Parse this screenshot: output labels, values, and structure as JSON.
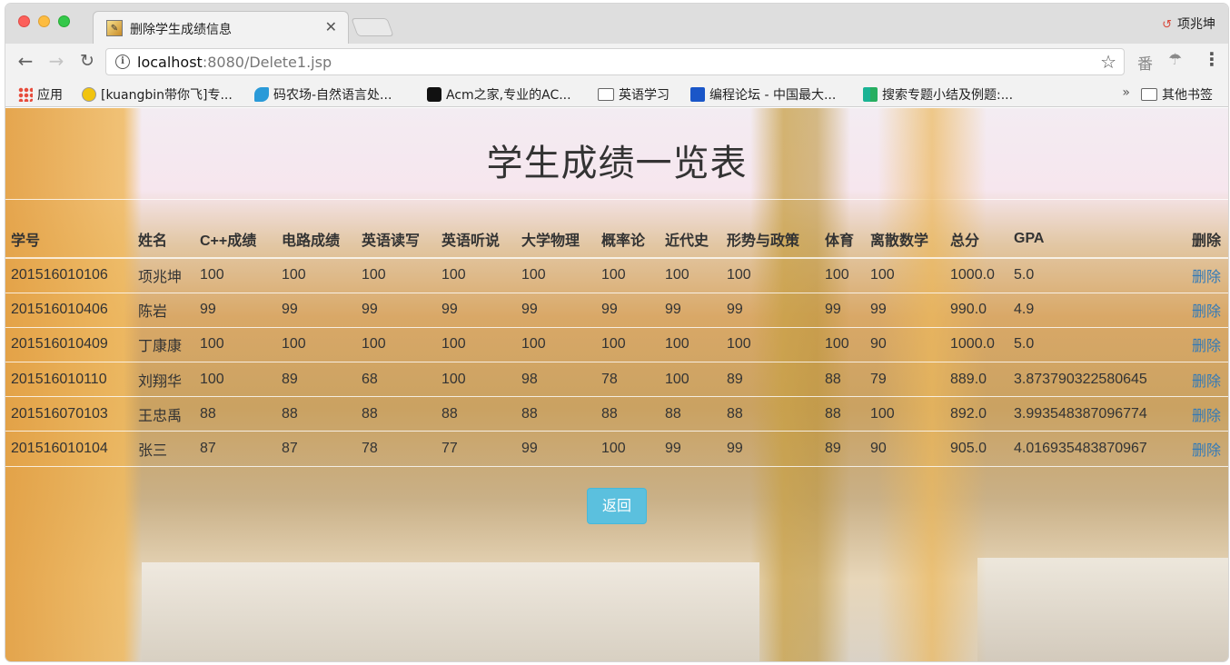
{
  "browser": {
    "tab_title": "删除学生成绩信息",
    "profile_name": "项兆坤",
    "url_host": "localhost",
    "url_rest": ":8080/Delete1.jsp",
    "bookmarks": [
      {
        "label": "应用",
        "icon": "apps-grid-icon"
      },
      {
        "label": "[kuangbin带你飞]专...",
        "icon": "smiley-icon"
      },
      {
        "label": "码农场-自然语言处...",
        "icon": "bird-icon"
      },
      {
        "label": "Acm之家,专业的AC...",
        "icon": "acm-icon"
      },
      {
        "label": "英语学习",
        "icon": "folder-icon"
      },
      {
        "label": "编程论坛 - 中国最大...",
        "icon": "bian-icon"
      },
      {
        "label": "搜索专题小结及例题:...",
        "icon": "search-logo-icon"
      }
    ],
    "more_chevron": "»",
    "other_bookmarks": "其他书签"
  },
  "page": {
    "title": "学生成绩一览表",
    "back_label": "返回",
    "delete_header": "删除",
    "delete_label": "删除",
    "columns": [
      "学号",
      "姓名",
      "C++成绩",
      "电路成绩",
      "英语读写",
      "英语听说",
      "大学物理",
      "概率论",
      "近代史",
      "形势与政策",
      "体育",
      "离散数学",
      "总分",
      "GPA"
    ],
    "rows": [
      [
        "201516010106",
        "项兆坤",
        "100",
        "100",
        "100",
        "100",
        "100",
        "100",
        "100",
        "100",
        "100",
        "100",
        "1000.0",
        "5.0"
      ],
      [
        "201516010406",
        "陈岩",
        "99",
        "99",
        "99",
        "99",
        "99",
        "99",
        "99",
        "99",
        "99",
        "99",
        "990.0",
        "4.9"
      ],
      [
        "201516010409",
        "丁康康",
        "100",
        "100",
        "100",
        "100",
        "100",
        "100",
        "100",
        "100",
        "100",
        "90",
        "1000.0",
        "5.0"
      ],
      [
        "201516010110",
        "刘翔华",
        "100",
        "89",
        "68",
        "100",
        "98",
        "78",
        "100",
        "89",
        "88",
        "79",
        "889.0",
        "3.873790322580645"
      ],
      [
        "201516070103",
        "王忠禹",
        "88",
        "88",
        "88",
        "88",
        "88",
        "88",
        "88",
        "88",
        "88",
        "100",
        "892.0",
        "3.993548387096774"
      ],
      [
        "201516010104",
        "张三",
        "87",
        "87",
        "78",
        "77",
        "99",
        "100",
        "99",
        "99",
        "89",
        "90",
        "905.0",
        "4.016935483870967"
      ]
    ]
  }
}
